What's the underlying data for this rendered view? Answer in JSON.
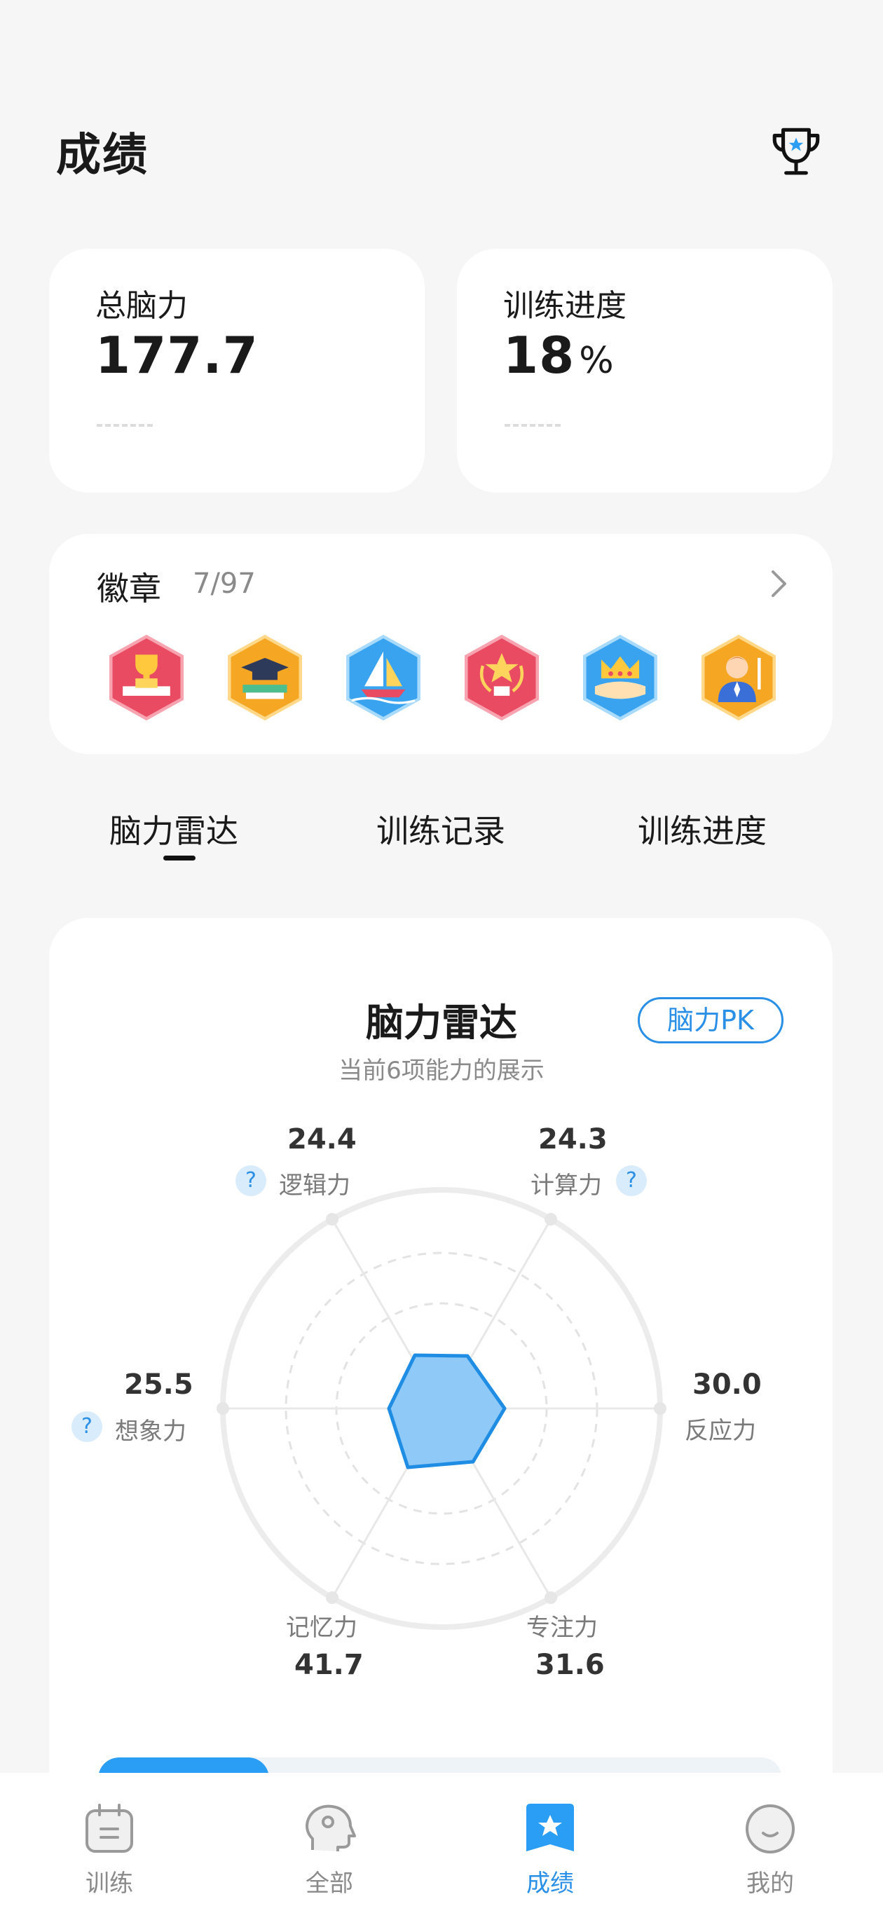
{
  "header": {
    "title": "成绩"
  },
  "stats": {
    "total_brain": {
      "label": "总脑力",
      "value": "177.7"
    },
    "training_progress": {
      "label": "训练进度",
      "value": "18",
      "unit": "%"
    }
  },
  "badges": {
    "title": "徽章",
    "count": "7/97",
    "items": [
      "trophy-badge",
      "graduation-badge",
      "sailboat-badge",
      "star-award-badge",
      "crown-badge",
      "person-badge"
    ]
  },
  "tabs": [
    {
      "label": "脑力雷达",
      "active": true
    },
    {
      "label": "训练记录",
      "active": false
    },
    {
      "label": "训练进度",
      "active": false
    }
  ],
  "radar": {
    "title": "脑力雷达",
    "subtitle": "当前6项能力的展示",
    "pk_button": "脑力PK",
    "abilities": [
      {
        "name": "逻辑力",
        "value": "24.4"
      },
      {
        "name": "计算力",
        "value": "24.3"
      },
      {
        "name": "反应力",
        "value": "30.0"
      },
      {
        "name": "专注力",
        "value": "31.6"
      },
      {
        "name": "记忆力",
        "value": "41.7"
      },
      {
        "name": "想象力",
        "value": "25.5"
      }
    ],
    "help_icon": "?"
  },
  "colors": {
    "accent": "#2a8fe6",
    "radar_fill": "#8ec9f7"
  },
  "bottom_nav": [
    {
      "label": "训练",
      "icon": "calendar-icon",
      "active": false
    },
    {
      "label": "全部",
      "icon": "head-icon",
      "active": false
    },
    {
      "label": "成绩",
      "icon": "star-badge-icon",
      "active": true
    },
    {
      "label": "我的",
      "icon": "smile-icon",
      "active": false
    }
  ]
}
